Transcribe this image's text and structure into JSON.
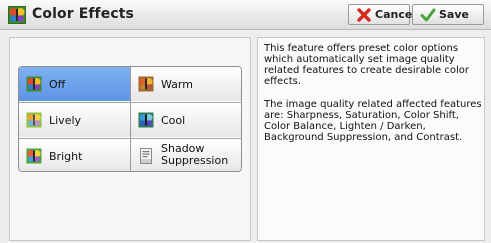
{
  "header": {
    "title": "Color Effects",
    "cancel_label": "Cancel",
    "save_label": "Save"
  },
  "options": {
    "off": "Off",
    "warm": "Warm",
    "lively": "Lively",
    "cool": "Cool",
    "bright": "Bright",
    "shadow_suppression_line1": "Shadow",
    "shadow_suppression_line2": "Suppression",
    "selected": "Off"
  },
  "description": {
    "paragraph1": "This feature offers preset color options which automatically set image quality related features to create desirable color effects.",
    "paragraph2": "The image quality related affected features are: Sharpness, Saturation, Color Shift, Color Balance, Lighten / Darken, Background Suppression, and Contrast."
  },
  "colors": {
    "selected_cell": "#6aa0ea",
    "accent_green": "#4aa53a"
  },
  "icons": {
    "title": "butterfly-icon",
    "cancel": "red-x-icon",
    "save": "green-check-icon"
  }
}
